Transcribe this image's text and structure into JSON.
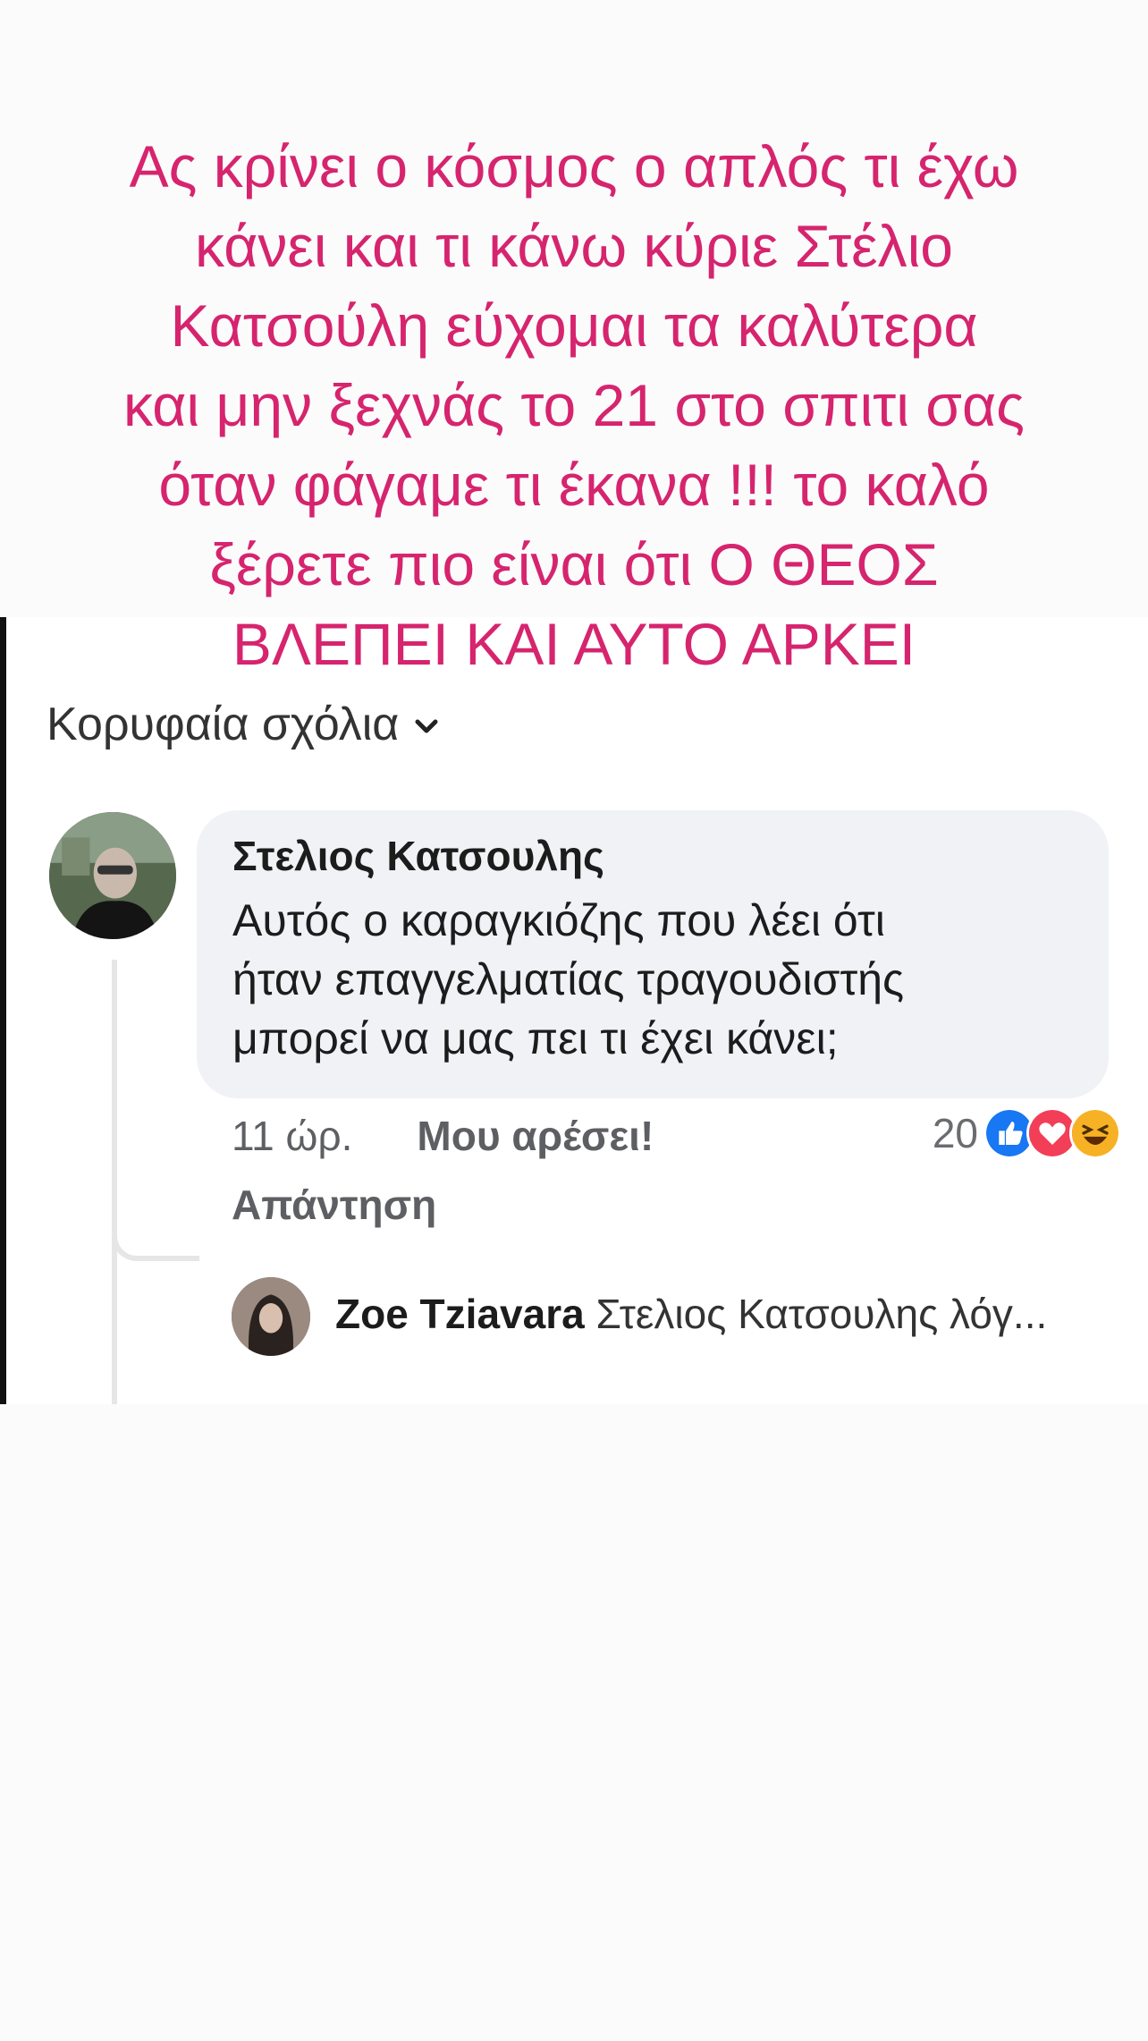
{
  "caption": {
    "lines": [
      "Ας κρίνει ο κόσμος ο απλός τι έχω",
      "κάνει και τι κάνω κύριε Στέλιο",
      "Κατσούλη εύχομαι τα καλύτερα",
      "και μην ξεχνάς το 21 στο σπιτι σας",
      "όταν φάγαμε τι έκανα !!!  το καλό",
      "ξέρετε πιο είναι ότι Ο ΘΕΟΣ",
      "ΒΛΕΠΕΙ ΚΑΙ ΑΥΤΟ ΑΡΚΕΙ"
    ],
    "color": "#d6246e"
  },
  "comments_header": {
    "sort_label": "Κορυφαία σχόλια",
    "icon": "chevron-down-icon"
  },
  "comment": {
    "author": "Στελιος Κατσουλης",
    "text_lines": [
      "Αυτός ο καραγκιόζης που λέει ότι",
      "ήταν επαγγελματίας τραγουδιστής",
      "μπορεί να μας πει τι έχει κάνει;"
    ],
    "time": "11 ώρ.",
    "like_label": "Μου αρέσει!",
    "reply_label": "Απάντηση",
    "reaction_count": "20",
    "reactions": [
      "like-icon",
      "love-icon",
      "haha-icon"
    ]
  },
  "reply": {
    "author": "Zoe Tziavara",
    "preview": "Στελιος Κατσουλης λόγ..."
  },
  "colors": {
    "like": "#1877f2",
    "love": "#f33e58",
    "haha": "#f7b125",
    "bubble": "#f0f2f5"
  }
}
